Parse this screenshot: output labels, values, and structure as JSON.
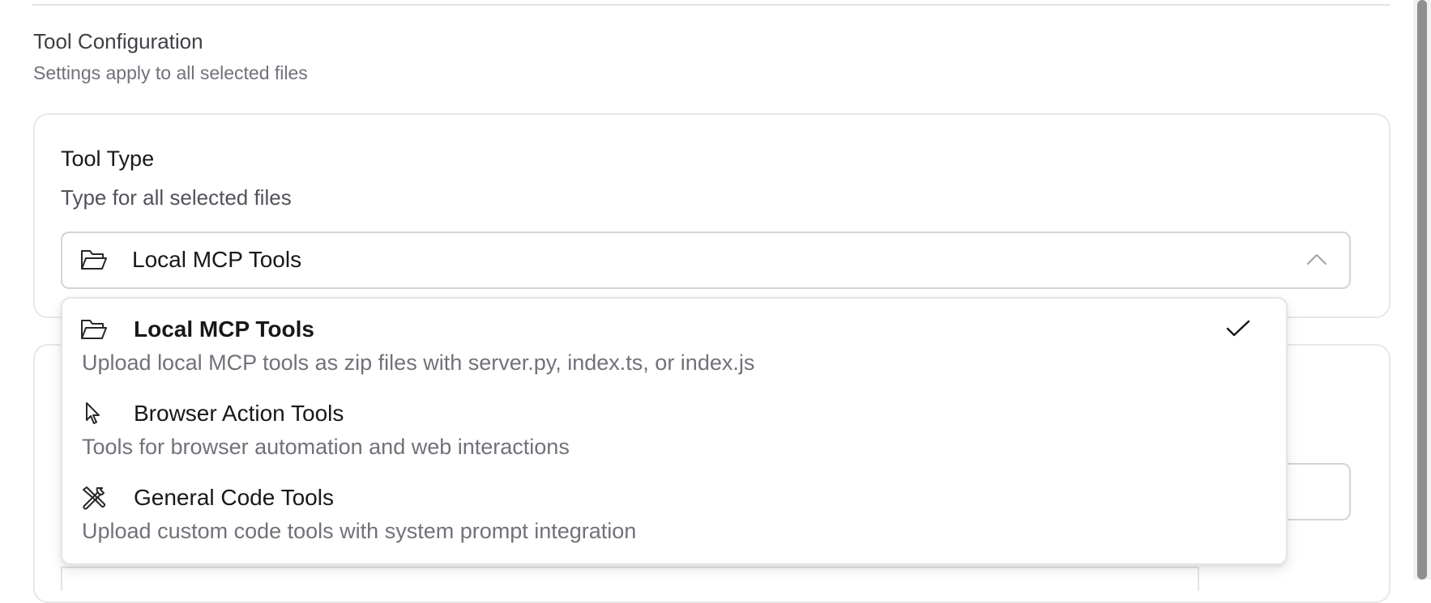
{
  "section": {
    "title": "Tool Configuration",
    "subtitle": "Settings apply to all selected files"
  },
  "tool_type": {
    "label": "Tool Type",
    "description": "Type for all selected files",
    "selected_value": "Local MCP Tools",
    "selected_icon": "folder-open-icon",
    "expanded": true
  },
  "dropdown": {
    "options": [
      {
        "label": "Local MCP Tools",
        "description": "Upload local MCP tools as zip files with server.py, index.ts, or index.js",
        "icon": "folder-open-icon",
        "selected": true
      },
      {
        "label": "Browser Action Tools",
        "description": "Tools for browser automation and web interactions",
        "icon": "cursor-pointer-icon",
        "selected": false
      },
      {
        "label": "General Code Tools",
        "description": "Upload custom code tools with system prompt integration",
        "icon": "tools-icon",
        "selected": false
      }
    ]
  },
  "colors": {
    "border": "#e4e4e7",
    "text_primary": "#18181b",
    "text_muted": "#71717a"
  }
}
